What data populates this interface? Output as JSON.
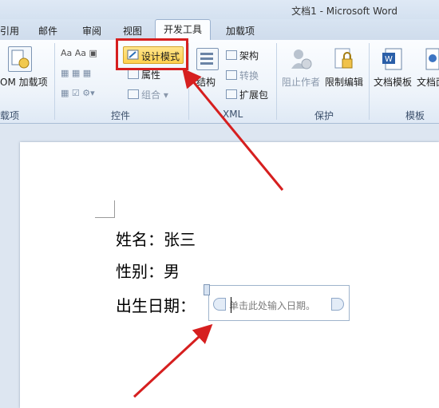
{
  "title": "文档1 - Microsoft Word",
  "tabs": [
    "引用",
    "邮件",
    "审阅",
    "视图",
    "开发工具",
    "加载项"
  ],
  "ribbon": {
    "addins": {
      "com_label": "OM 加载项",
      "group": "载项"
    },
    "controls": {
      "design_mode": "设计模式",
      "properties": "属性",
      "group_btn": "组合",
      "group": "控件"
    },
    "xml": {
      "structure": "结构",
      "schema": "架构",
      "transform": "转换",
      "expansion": "扩展包",
      "group": "XML"
    },
    "protect": {
      "block_authors": "阻止作者",
      "restrict_editing": "限制编辑",
      "group": "保护"
    },
    "templates": {
      "doc_template": "文档模板",
      "doc_panel": "文档面",
      "group": "模板"
    }
  },
  "document": {
    "line1": "姓名：张三",
    "line2": "性别：男",
    "line3": "出生日期：",
    "date_placeholder": "单击此处输入日期。"
  },
  "colors": {
    "highlight": "#d61f1f",
    "design_active": "#ffd04d"
  },
  "icons": [
    "com-addin-icon",
    "design-mode-icon",
    "properties-icon",
    "structure-icon",
    "schema-icon",
    "block-authors-icon",
    "restrict-editing-icon",
    "doc-template-icon"
  ]
}
